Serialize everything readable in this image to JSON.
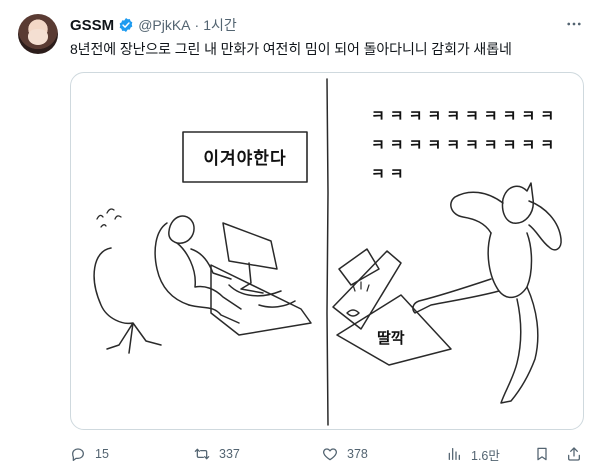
{
  "tweet": {
    "author": {
      "name": "GSSM",
      "handle": "@PjkKA",
      "time": "1시간"
    },
    "text": "8년전에 장난으로 그린 내 만화가 여전히 밈이 되어 돌아다니니 감회가 새롭네",
    "media": {
      "left_panel_caption": "이겨야한다",
      "right_panel_laugh_lines": [
        "ㅋㅋㅋㅋㅋㅋㅋㅋㅋㅋ",
        "ㅋㅋㅋㅋㅋㅋㅋㅋㅋㅋ",
        "ㅋㅋ"
      ],
      "right_panel_sfx": "딸깍"
    }
  },
  "actions": {
    "reply_count": "15",
    "retweet_count": "337",
    "like_count": "378",
    "view_count": "1.6만"
  },
  "icons": {
    "verified": "verified-badge-icon",
    "more": "more-icon",
    "reply": "reply-icon",
    "retweet": "retweet-icon",
    "like": "heart-icon",
    "views": "views-icon",
    "bookmark": "bookmark-icon",
    "share": "share-icon"
  },
  "colors": {
    "verified": "#1d9bf0",
    "secondary_text": "#536471"
  }
}
